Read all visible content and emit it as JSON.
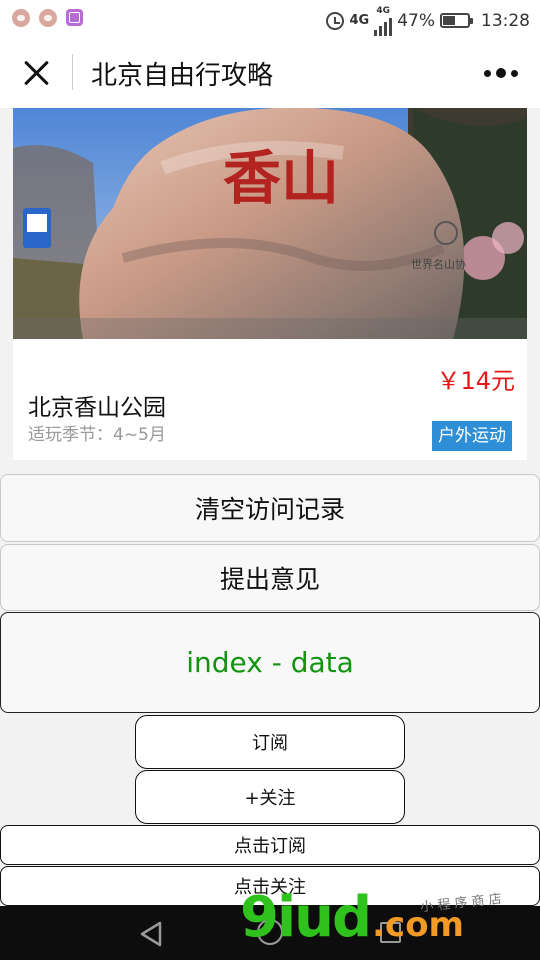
{
  "status_bar": {
    "network_main": "4G",
    "network_small": "4G",
    "battery": "47%",
    "battery_level": 0.47,
    "time": "13:28",
    "icons": [
      "notification-icon",
      "notification-icon",
      "gallery-icon",
      "alarm-icon",
      "signal-icon",
      "battery-icon"
    ]
  },
  "nav": {
    "title": "北京自由行攻略",
    "close_icon": "close-icon",
    "more_icon": "more-icon"
  },
  "card": {
    "image_text": "香山",
    "price": "￥14元",
    "name": "北京香山公园",
    "season": "适玩季节：4~5月",
    "tag": "户外运动"
  },
  "buttons": {
    "clear_history": "清空访问记录",
    "feedback": "提出意见",
    "index_data": "index - data",
    "subscribe": "订阅",
    "follow": "+关注",
    "click_subscribe": "点击订阅",
    "click_follow": "点击关注"
  },
  "watermark": {
    "main": "9iud",
    "suffix": ".com",
    "tagline": "小 程 序 商 店"
  },
  "colors": {
    "price": "#e21a1a",
    "tag_bg": "#2f8fd6",
    "index_data": "#129412",
    "watermark_green": "#2fc21c",
    "watermark_orange": "#f19a26"
  }
}
